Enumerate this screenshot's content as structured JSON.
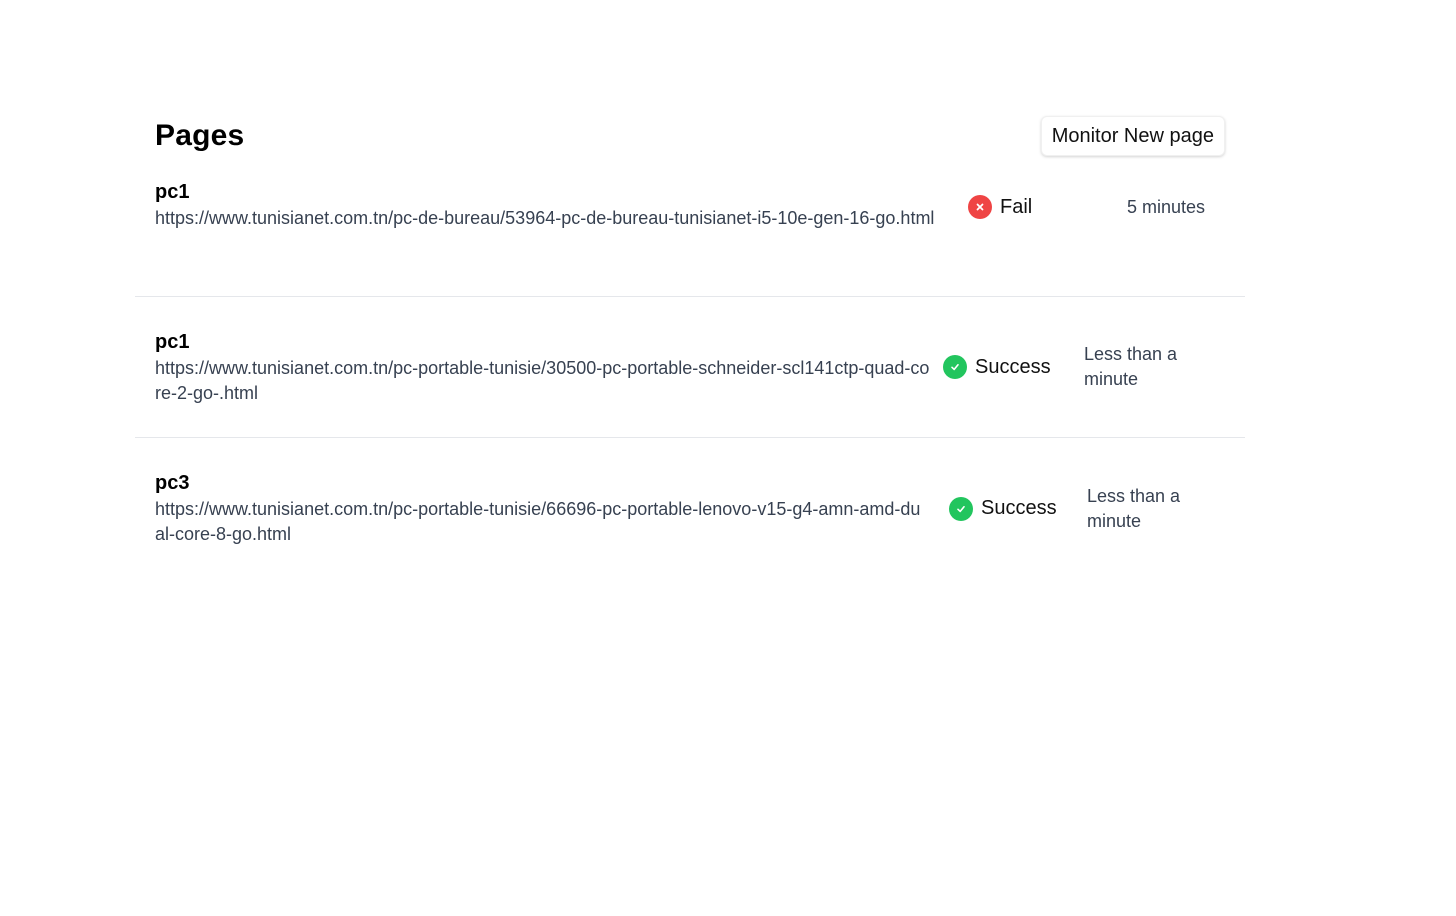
{
  "header": {
    "title": "Pages",
    "monitor_button_label": "Monitor New page"
  },
  "colors": {
    "fail": "#ef4444",
    "success": "#22c55e"
  },
  "pages": [
    {
      "name": "pc1",
      "url": "https://www.tunisianet.com.tn/pc-de-bureau/53964-pc-de-bureau-tunisianet-i5-10e-gen-16-go.html",
      "status": "Fail",
      "status_icon": "x-circle-icon",
      "last_checked": "5 minutes"
    },
    {
      "name": "pc1",
      "url": "https://www.tunisianet.com.tn/pc-portable-tunisie/30500-pc-portable-schneider-scl141ctp-quad-core-2-go-.html",
      "status": "Success",
      "status_icon": "check-circle-icon",
      "last_checked": "Less than a minute"
    },
    {
      "name": "pc3",
      "url": "https://www.tunisianet.com.tn/pc-portable-tunisie/66696-pc-portable-lenovo-v15-g4-amn-amd-dual-core-8-go.html",
      "status": "Success",
      "status_icon": "check-circle-icon",
      "last_checked": "Less than a minute"
    }
  ]
}
